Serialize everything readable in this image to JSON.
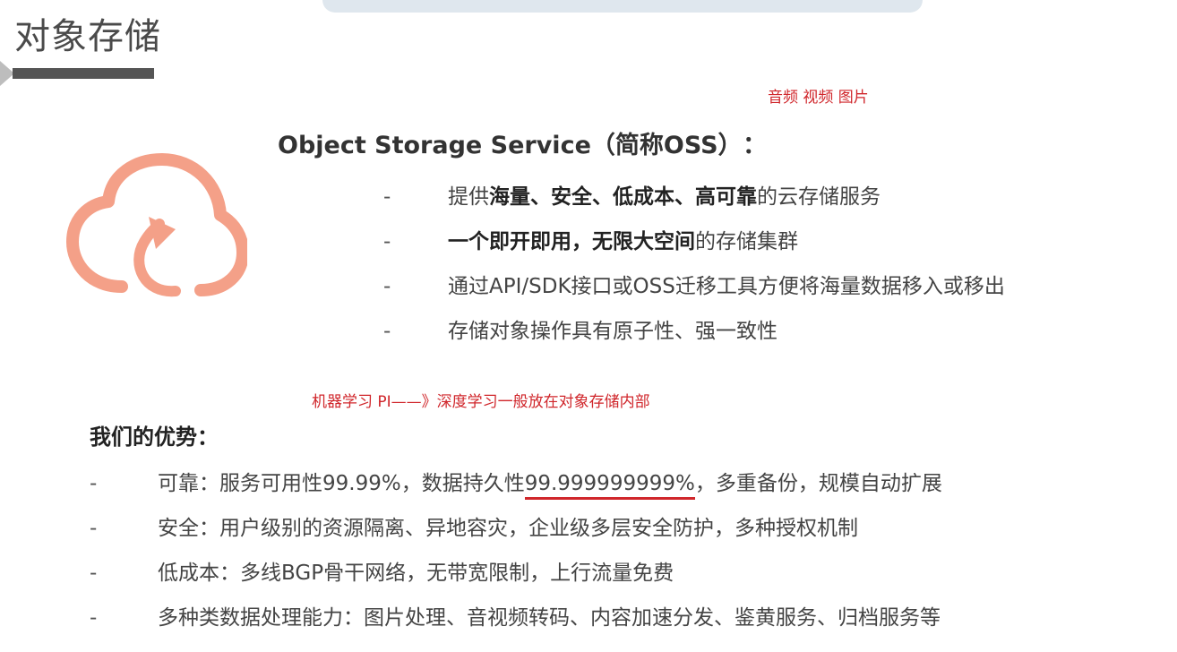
{
  "page": {
    "title": "对象存储"
  },
  "annotations": {
    "media": "音频 视频 图片",
    "ml": "机器学习 PI——》深度学习一般放在对象存储内部"
  },
  "logo": {
    "icon": "cloud-upload-icon",
    "color": "#f4a088"
  },
  "oss": {
    "heading": "Object Storage Service（简称OSS）",
    "colon": "：",
    "dash": "-",
    "features": [
      {
        "parts": [
          {
            "t": "提供",
            "b": false
          },
          {
            "t": "海量、安全、低成本、高可靠",
            "b": true
          },
          {
            "t": "的云存储服务",
            "b": false
          }
        ]
      },
      {
        "parts": [
          {
            "t": "一个即开即用，无限大空间",
            "b": true
          },
          {
            "t": "的存储集群",
            "b": false
          }
        ]
      },
      {
        "parts": [
          {
            "t": "通过API/SDK接口或OSS迁移工具方便将海量数据移入或移出",
            "b": false
          }
        ]
      },
      {
        "parts": [
          {
            "t": "存储对象操作具有原子性、强一致性",
            "b": false
          }
        ]
      }
    ]
  },
  "advantages": {
    "heading": "我们的优势：",
    "dash": "-",
    "items": [
      {
        "before": "可靠：服务可用性99.99%，数据持久性",
        "highlight": "99.999999999%",
        "after": "，多重备份，规模自动扩展"
      },
      {
        "text": "安全：用户级别的资源隔离、异地容灾，企业级多层安全防护，多种授权机制"
      },
      {
        "text": "低成本：多线BGP骨干网络，无带宽限制，上行流量免费"
      },
      {
        "text": "多种类数据处理能力：图片处理、音视频转码、内容加速分发、鉴黄服务、归档服务等"
      }
    ]
  },
  "colors": {
    "annotation": "#d0262b"
  }
}
